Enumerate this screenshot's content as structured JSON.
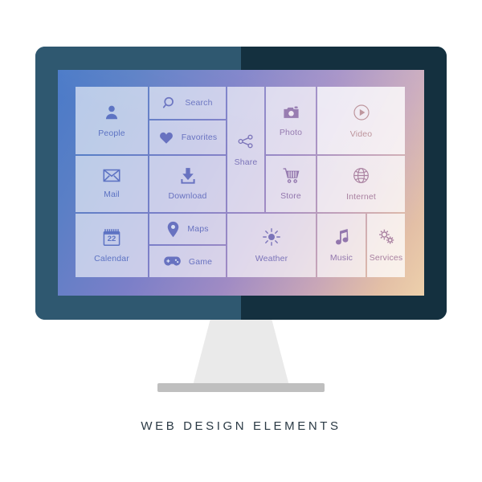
{
  "caption": "WEB  DESIGN  ELEMENTS",
  "device": {
    "name": "desktop-monitor",
    "bezel_left_color": "#2f5870",
    "bezel_right_color": "#14303f",
    "stand_color": "#eaeaea",
    "stand_base_color": "#bfbfbf"
  },
  "screen": {
    "gradient_from": "#4a7ac8",
    "gradient_mid": "#a08bc4",
    "gradient_to": "#edd0ab"
  },
  "tiles": [
    {
      "id": "people",
      "label": "People",
      "icon": "person-icon",
      "layout": "vertical",
      "tone": "t-a"
    },
    {
      "id": "search",
      "label": "Search",
      "icon": "magnifier-icon",
      "layout": "horizontal",
      "tone": "t-b"
    },
    {
      "id": "favorites",
      "label": "Favorites",
      "icon": "heart-icon",
      "layout": "horizontal",
      "tone": "t-b"
    },
    {
      "id": "share",
      "label": "Share",
      "icon": "share-nodes-icon",
      "layout": "vertical",
      "tone": "t-c"
    },
    {
      "id": "photo",
      "label": "Photo",
      "icon": "camera-icon",
      "layout": "vertical",
      "tone": "t-d"
    },
    {
      "id": "video",
      "label": "Video",
      "icon": "play-circle-icon",
      "layout": "vertical",
      "tone": "t-f"
    },
    {
      "id": "mail",
      "label": "Mail",
      "icon": "envelope-icon",
      "layout": "vertical",
      "tone": "t-a"
    },
    {
      "id": "download",
      "label": "Download",
      "icon": "download-icon",
      "layout": "vertical",
      "tone": "t-b"
    },
    {
      "id": "store",
      "label": "Store",
      "icon": "shopping-cart-icon",
      "layout": "vertical",
      "tone": "t-d"
    },
    {
      "id": "internet",
      "label": "Internet",
      "icon": "globe-icon",
      "layout": "vertical",
      "tone": "t-e"
    },
    {
      "id": "calendar",
      "label": "Calendar",
      "icon": "calendar-icon",
      "layout": "vertical",
      "tone": "t-a",
      "badge": "22"
    },
    {
      "id": "maps",
      "label": "Maps",
      "icon": "map-pin-icon",
      "layout": "horizontal",
      "tone": "t-b"
    },
    {
      "id": "game",
      "label": "Game",
      "icon": "gamepad-icon",
      "layout": "horizontal",
      "tone": "t-b"
    },
    {
      "id": "weather",
      "label": "Weather",
      "icon": "sun-icon",
      "layout": "vertical",
      "tone": "t-c"
    },
    {
      "id": "music",
      "label": "Music",
      "icon": "music-note-icon",
      "layout": "vertical",
      "tone": "t-d"
    },
    {
      "id": "services",
      "label": "Services",
      "icon": "gears-icon",
      "layout": "vertical",
      "tone": "t-e"
    }
  ]
}
